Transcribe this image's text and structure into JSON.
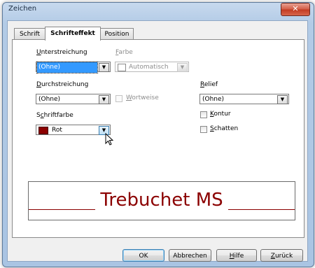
{
  "window": {
    "title": "Zeichen",
    "close_glyph": "✕"
  },
  "tabs": [
    {
      "label": "Schrift",
      "active": false
    },
    {
      "label": "Schrifteffekt",
      "active": true
    },
    {
      "label": "Position",
      "active": false
    }
  ],
  "underline": {
    "label_prefix": "",
    "label_u": "U",
    "label_rest": "nterstreichung",
    "value": "(Ohne)"
  },
  "color": {
    "label_u": "F",
    "label_rest": "arbe",
    "value": "Automatisch"
  },
  "strikethrough": {
    "label_u": "D",
    "label_rest": "urchstreichung",
    "value": "(Ohne)"
  },
  "wordwise": {
    "label_u": "W",
    "label_rest": "ortweise",
    "checked": false
  },
  "relief": {
    "label_u": "R",
    "label_rest": "elief",
    "value": "(Ohne)"
  },
  "fontcolor": {
    "label_pre": "S",
    "label_u": "c",
    "label_rest": "hriftfarbe",
    "value": "Rot",
    "swatch": "#8b0000"
  },
  "outline": {
    "label_u": "K",
    "label_rest": "ontur",
    "checked": false
  },
  "shadow": {
    "label_u": "S",
    "label_rest": "chatten",
    "checked": false
  },
  "preview": {
    "text": "Trebuchet MS",
    "color": "#8b0000"
  },
  "buttons": {
    "ok": "OK",
    "cancel": "Abbrechen",
    "help_u": "H",
    "help_rest": "ilfe",
    "back_u": "Z",
    "back_rest": "urück"
  }
}
